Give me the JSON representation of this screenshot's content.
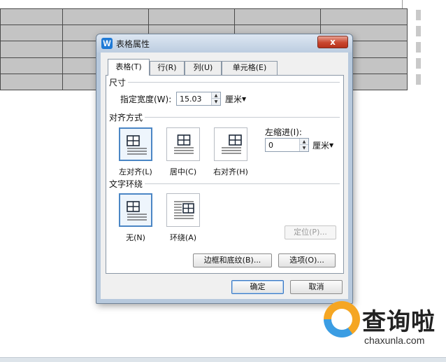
{
  "dialog": {
    "title": "表格属性",
    "app_icon": "W",
    "close_label": "x",
    "tabs": [
      {
        "label": "表格(T)"
      },
      {
        "label": "行(R)"
      },
      {
        "label": "列(U)"
      },
      {
        "label": "单元格(E)"
      }
    ],
    "size": {
      "heading": "尺寸",
      "width_label": "指定宽度(W):",
      "width_value": "15.03",
      "width_unit": "厘米"
    },
    "alignment": {
      "heading": "对齐方式",
      "options": [
        {
          "label": "左对齐(L)"
        },
        {
          "label": "居中(C)"
        },
        {
          "label": "右对齐(H)"
        }
      ],
      "indent_label": "左缩进(I):",
      "indent_value": "0",
      "indent_unit": "厘米"
    },
    "wrapping": {
      "heading": "文字环绕",
      "options": [
        {
          "label": "无(N)"
        },
        {
          "label": "环绕(A)"
        }
      ],
      "position_button": "定位(P)..."
    },
    "borders_button": "边框和底纹(B)...",
    "options_button": "选项(O)...",
    "ok_button": "确定",
    "cancel_button": "取消"
  },
  "watermark": {
    "text": "查询啦",
    "url": "chaxunla.com"
  },
  "colors": {
    "table_fill": "#c4c4c4",
    "dialog_frame": "#b7c9dd",
    "close_button": "#c9472f",
    "selected_border": "#4b86c5"
  }
}
